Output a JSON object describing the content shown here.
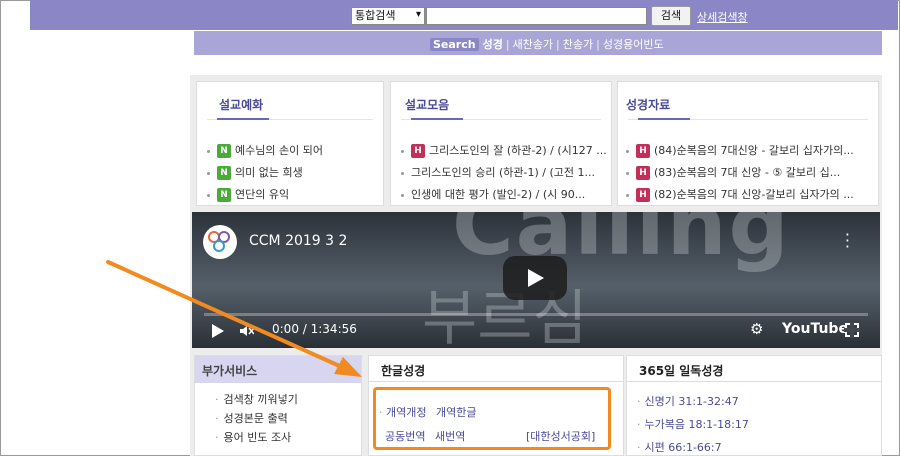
{
  "topbar": {
    "select_value": "통합검색",
    "search_value": "",
    "search_button": "검색",
    "advanced_link": "상세검색창"
  },
  "subbar": {
    "search_tag": "Search",
    "items": [
      "성경",
      "새찬송가",
      "찬송가",
      "성경용어빈도"
    ]
  },
  "panels": [
    {
      "title": "설교예화",
      "items": [
        {
          "badge": "N",
          "text": "예수님의 손이 되어"
        },
        {
          "badge": "N",
          "text": "의미 없는 희생"
        },
        {
          "badge": "N",
          "text": "연단의 유익"
        }
      ]
    },
    {
      "title": "설교모음",
      "items": [
        {
          "badge": "H",
          "text": "그리스도인의 잘 (하관-2) / (시127 ..."
        },
        {
          "badge": "",
          "text": "그리스도인의 승리 (하관-1) / (고전 1..."
        },
        {
          "badge": "",
          "text": "인생에 대한 평가 (발인-2) / (시 90..."
        }
      ]
    },
    {
      "title": "성경자료",
      "items": [
        {
          "badge": "H",
          "text": "(84)순복음의 7대신앙 - 갈보리 십자가의..."
        },
        {
          "badge": "H",
          "text": "(83)순복음의 7대 신앙 - ⑤ 갈보리 십..."
        },
        {
          "badge": "H",
          "text": "(82)순복음의 7대 신앙-갈보리 십자가의 ..."
        }
      ]
    }
  ],
  "video": {
    "title": "CCM 2019 3 2",
    "time": "0:00 / 1:34:56",
    "brand": "YouTube",
    "overlay_top": "Calling",
    "overlay_bottom": "부르심",
    "progress": 0
  },
  "extra": {
    "title": "부가서비스",
    "items": [
      "검색창 끼워넣기",
      "성경본문 출력",
      "용어 빈도 조사"
    ]
  },
  "bible": {
    "title": "한글성경",
    "row1": [
      "개역개정",
      "개역한글"
    ],
    "row2": [
      "공동번역",
      "새번역"
    ],
    "publisher": "[대한성서공회]"
  },
  "daily": {
    "title": "365일 일독성경",
    "items": [
      "신명기 31:1-32:47",
      "누가복음 18:1-18:17",
      "시편 66:1-66:7"
    ]
  },
  "colors": {
    "header": "#8b86c6",
    "annotation": "#f18a1f",
    "badge_new": "#4bab3a",
    "badge_hot": "#c2305a"
  }
}
